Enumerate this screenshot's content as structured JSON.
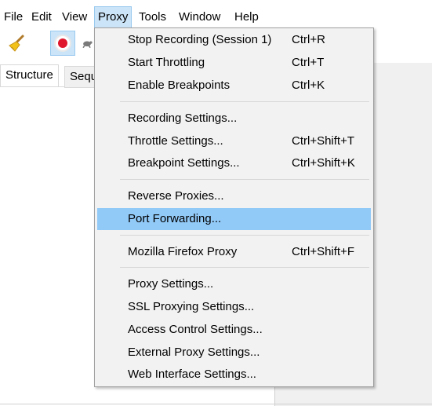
{
  "menubar": {
    "items": [
      "File",
      "Edit",
      "View",
      "Proxy",
      "Tools",
      "Window",
      "Help"
    ],
    "active": "Proxy"
  },
  "toolbar": {
    "buttons": [
      {
        "name": "clear-session",
        "icon": "broom-icon",
        "pressed": false
      },
      {
        "name": "record",
        "icon": "record-icon",
        "pressed": true
      },
      {
        "name": "throttle",
        "icon": "turtle-icon",
        "pressed": false
      }
    ]
  },
  "tabs": {
    "structure": "Structure",
    "sequence": "Seque"
  },
  "proxy_menu": {
    "groups": [
      [
        {
          "label": "Stop Recording (Session 1)",
          "shortcut": "Ctrl+R"
        },
        {
          "label": "Start Throttling",
          "shortcut": "Ctrl+T"
        },
        {
          "label": "Enable Breakpoints",
          "shortcut": "Ctrl+K"
        }
      ],
      [
        {
          "label": "Recording Settings...",
          "shortcut": ""
        },
        {
          "label": "Throttle Settings...",
          "shortcut": "Ctrl+Shift+T"
        },
        {
          "label": "Breakpoint Settings...",
          "shortcut": "Ctrl+Shift+K"
        }
      ],
      [
        {
          "label": "Reverse Proxies...",
          "shortcut": ""
        },
        {
          "label": "Port Forwarding...",
          "shortcut": "",
          "highlighted": true
        }
      ],
      [
        {
          "label": "Mozilla Firefox Proxy",
          "shortcut": "Ctrl+Shift+F"
        }
      ],
      [
        {
          "label": "Proxy Settings...",
          "shortcut": ""
        },
        {
          "label": "SSL Proxying Settings...",
          "shortcut": ""
        },
        {
          "label": "Access Control Settings...",
          "shortcut": ""
        },
        {
          "label": "External Proxy Settings...",
          "shortcut": ""
        },
        {
          "label": "Web Interface Settings...",
          "shortcut": ""
        }
      ]
    ]
  },
  "colors": {
    "menu_highlight": "#91c9f7",
    "active_menu_bg": "#cce4f7",
    "record_red": "#e0182d"
  }
}
